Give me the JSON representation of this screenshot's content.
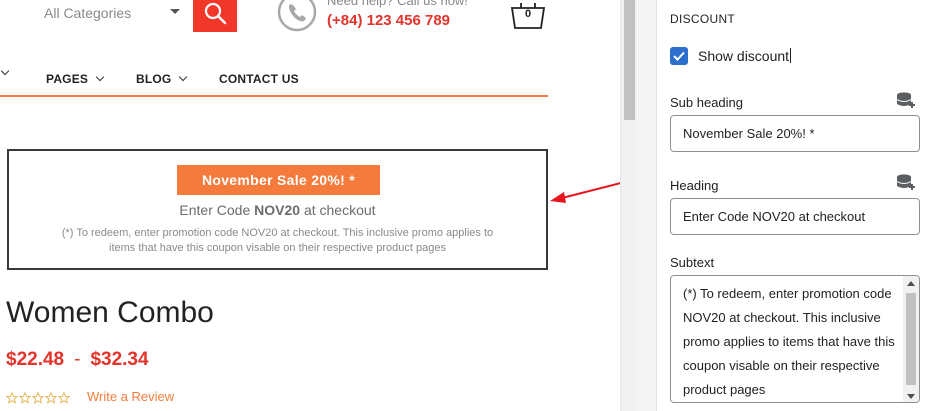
{
  "header": {
    "category_select": "All Categories",
    "help_text": "Need help? Call us now!",
    "phone": "(+84) 123 456 789",
    "cart_count": "0"
  },
  "nav": {
    "items": [
      {
        "label": "PAGES"
      },
      {
        "label": "BLOG"
      },
      {
        "label": "CONTACT US"
      }
    ]
  },
  "promo": {
    "sub_heading": "November Sale 20%! *",
    "heading_prefix": "Enter Code ",
    "heading_code": "NOV20",
    "heading_suffix": " at checkout",
    "subtext": "(*) To redeem, enter promotion code NOV20 at checkout. This inclusive promo applies to items that have this coupon visable on their respective product pages"
  },
  "product": {
    "title": "Women Combo",
    "price_min": "$22.48",
    "price_sep": "-",
    "price_max": "$32.34",
    "rating": 0,
    "review_link": "Write a Review"
  },
  "panel": {
    "section_title": "DISCOUNT",
    "show_discount_label": "Show discount",
    "show_discount_checked": true,
    "sub_heading_label": "Sub heading",
    "sub_heading_value": "November Sale 20%! *",
    "heading_label": "Heading",
    "heading_value": "Enter Code NOV20 at checkout",
    "subtext_label": "Subtext",
    "subtext_value": "(*) To redeem, enter promotion code NOV20 at checkout. This inclusive promo applies to items that have this coupon visable on their respective product pages"
  },
  "colors": {
    "accent_orange": "#f47b3c",
    "price_red": "#e2342a",
    "search_red": "#f0372a",
    "checkbox_blue": "#2c6ecb"
  },
  "icons": [
    "search-icon",
    "phone-icon",
    "cart-icon",
    "chevron-down-icon",
    "star-icon",
    "arrow-icon",
    "checkmark-icon",
    "database-add-icon"
  ]
}
